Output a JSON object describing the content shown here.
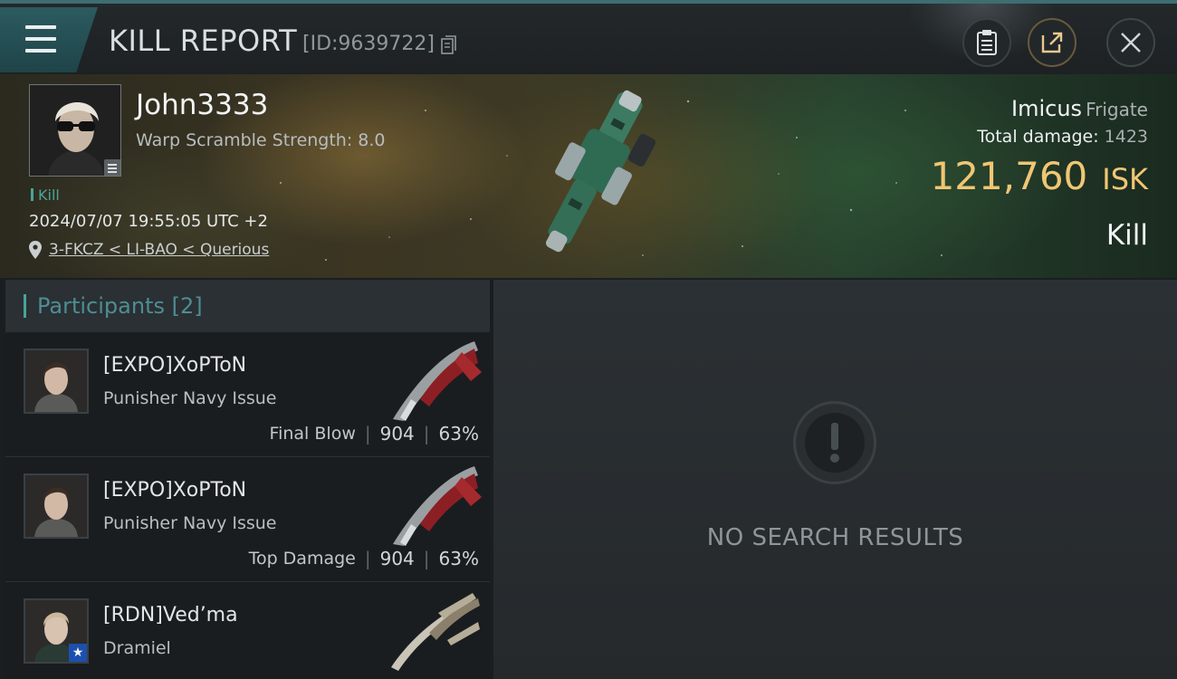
{
  "header": {
    "title": "KILL REPORT",
    "report_id": "[ID:9639722]"
  },
  "victim": {
    "name": "John3333",
    "warp_scramble": "Warp Scramble Strength: 8.0",
    "tag": "Kill",
    "datetime": "2024/07/07 19:55:05 UTC +2",
    "location": "3-FKCZ < LI-BAO < Querious",
    "ship_name": "Imicus",
    "ship_class": "Frigate",
    "total_damage_label": "Total damage:",
    "total_damage": "1423",
    "isk_value": "121,760",
    "isk_unit": "ISK",
    "result": "Kill"
  },
  "participants": {
    "label": "Participants",
    "count": "[2]",
    "rows": [
      {
        "name": "[EXPO]XoPToN",
        "ship": "Punisher Navy Issue",
        "role": "Final Blow",
        "damage": "904",
        "percent": "63%"
      },
      {
        "name": "[EXPO]XoPToN",
        "ship": "Punisher Navy Issue",
        "role": "Top Damage",
        "damage": "904",
        "percent": "63%"
      },
      {
        "name": "[RDN]Ved’ma",
        "ship": "Dramiel"
      }
    ]
  },
  "results": {
    "message": "NO SEARCH RESULTS"
  },
  "colors": {
    "accent_teal": "#4aa39a",
    "isk_gold": "#f0c674"
  }
}
